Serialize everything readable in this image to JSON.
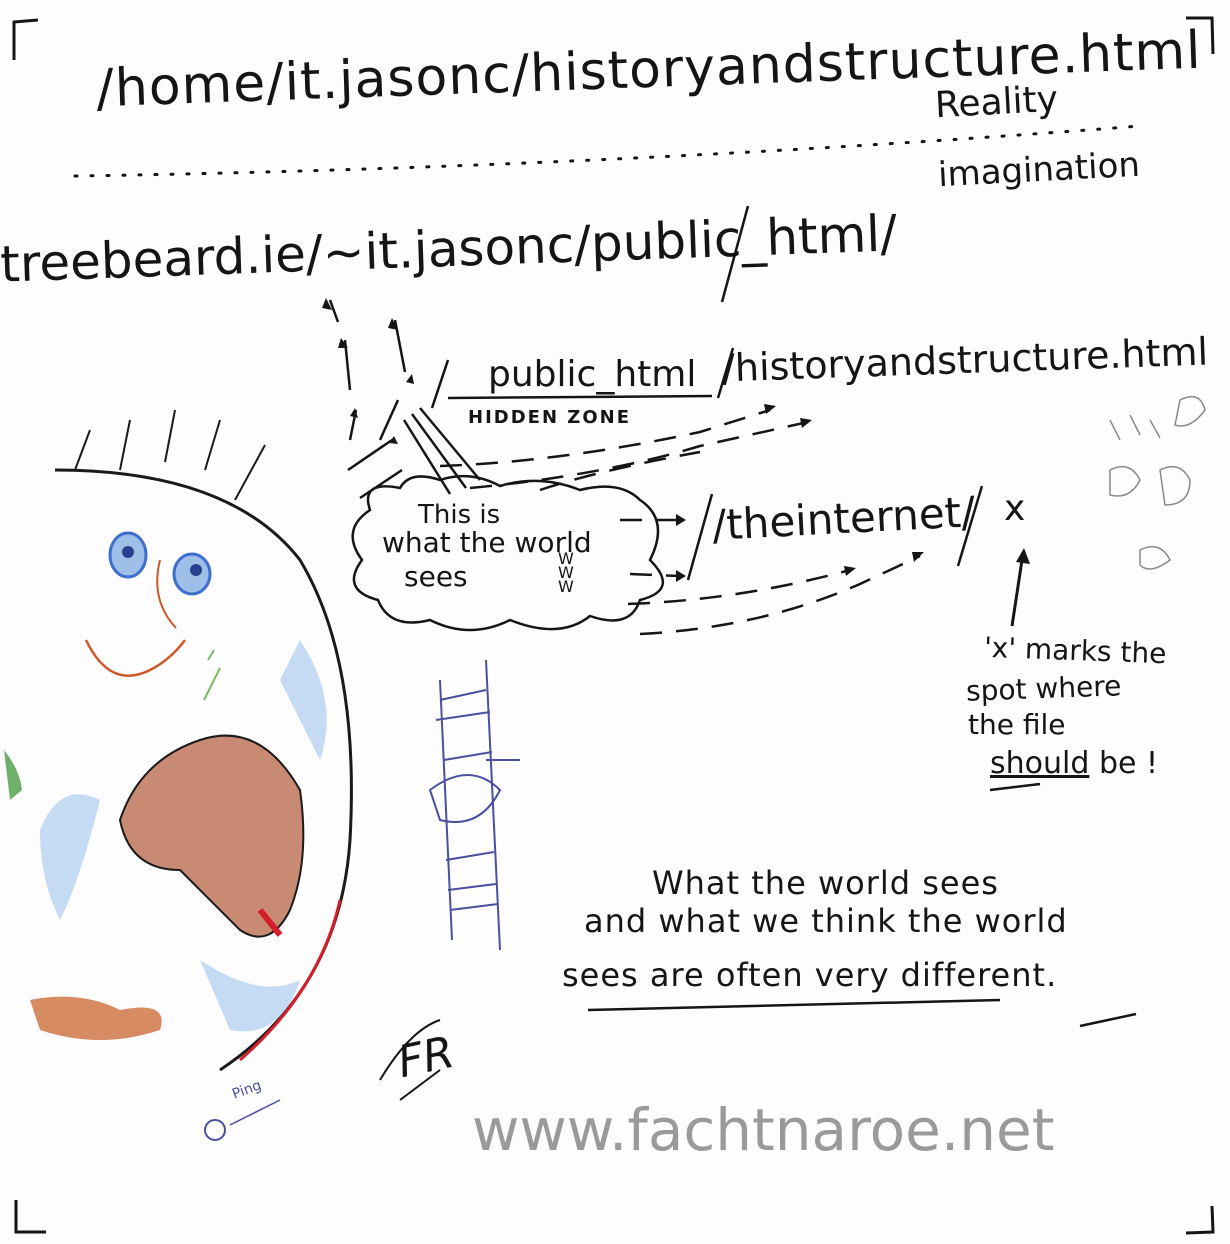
{
  "paths": {
    "top": "/home/it.jasonc/historyandstructure.html",
    "middle": "treebeard.ie/~it.jasonc/public_html/",
    "lower_hidden": "public_html",
    "lower_rest": "/historyandstructure.html",
    "internet": "/theinternet/",
    "x_mark": "x"
  },
  "labels": {
    "reality": "Reality",
    "imagination": "imagination",
    "hidden_zone": "HIDDEN ZONE",
    "cloud_line1": "This is",
    "cloud_line2": "what the world",
    "cloud_line3": "sees",
    "cloud_www": "WWW"
  },
  "x_note": {
    "line1": "'x' marks the",
    "line2": "spot where",
    "line3": "the file",
    "line4_prefix": "",
    "should": "should",
    "line4_suffix": "be !"
  },
  "summary": {
    "line1": "What the world sees",
    "line2": "and what we think the world",
    "line3": "sees are often very different."
  },
  "signature": "FR",
  "ping": "Ping",
  "watermark": "www.fachtnaroe.net",
  "colors": {
    "ink": "#151515",
    "watermark": "#9a9a9a",
    "earth_outline": "#1a1a1a",
    "eye_blue": "#3d6ecf",
    "mouth": "#d0562a",
    "land": "#a8553a",
    "ocean": "#9dbfe8",
    "accent_red": "#d41e2a",
    "tower": "#4a4f9e"
  }
}
